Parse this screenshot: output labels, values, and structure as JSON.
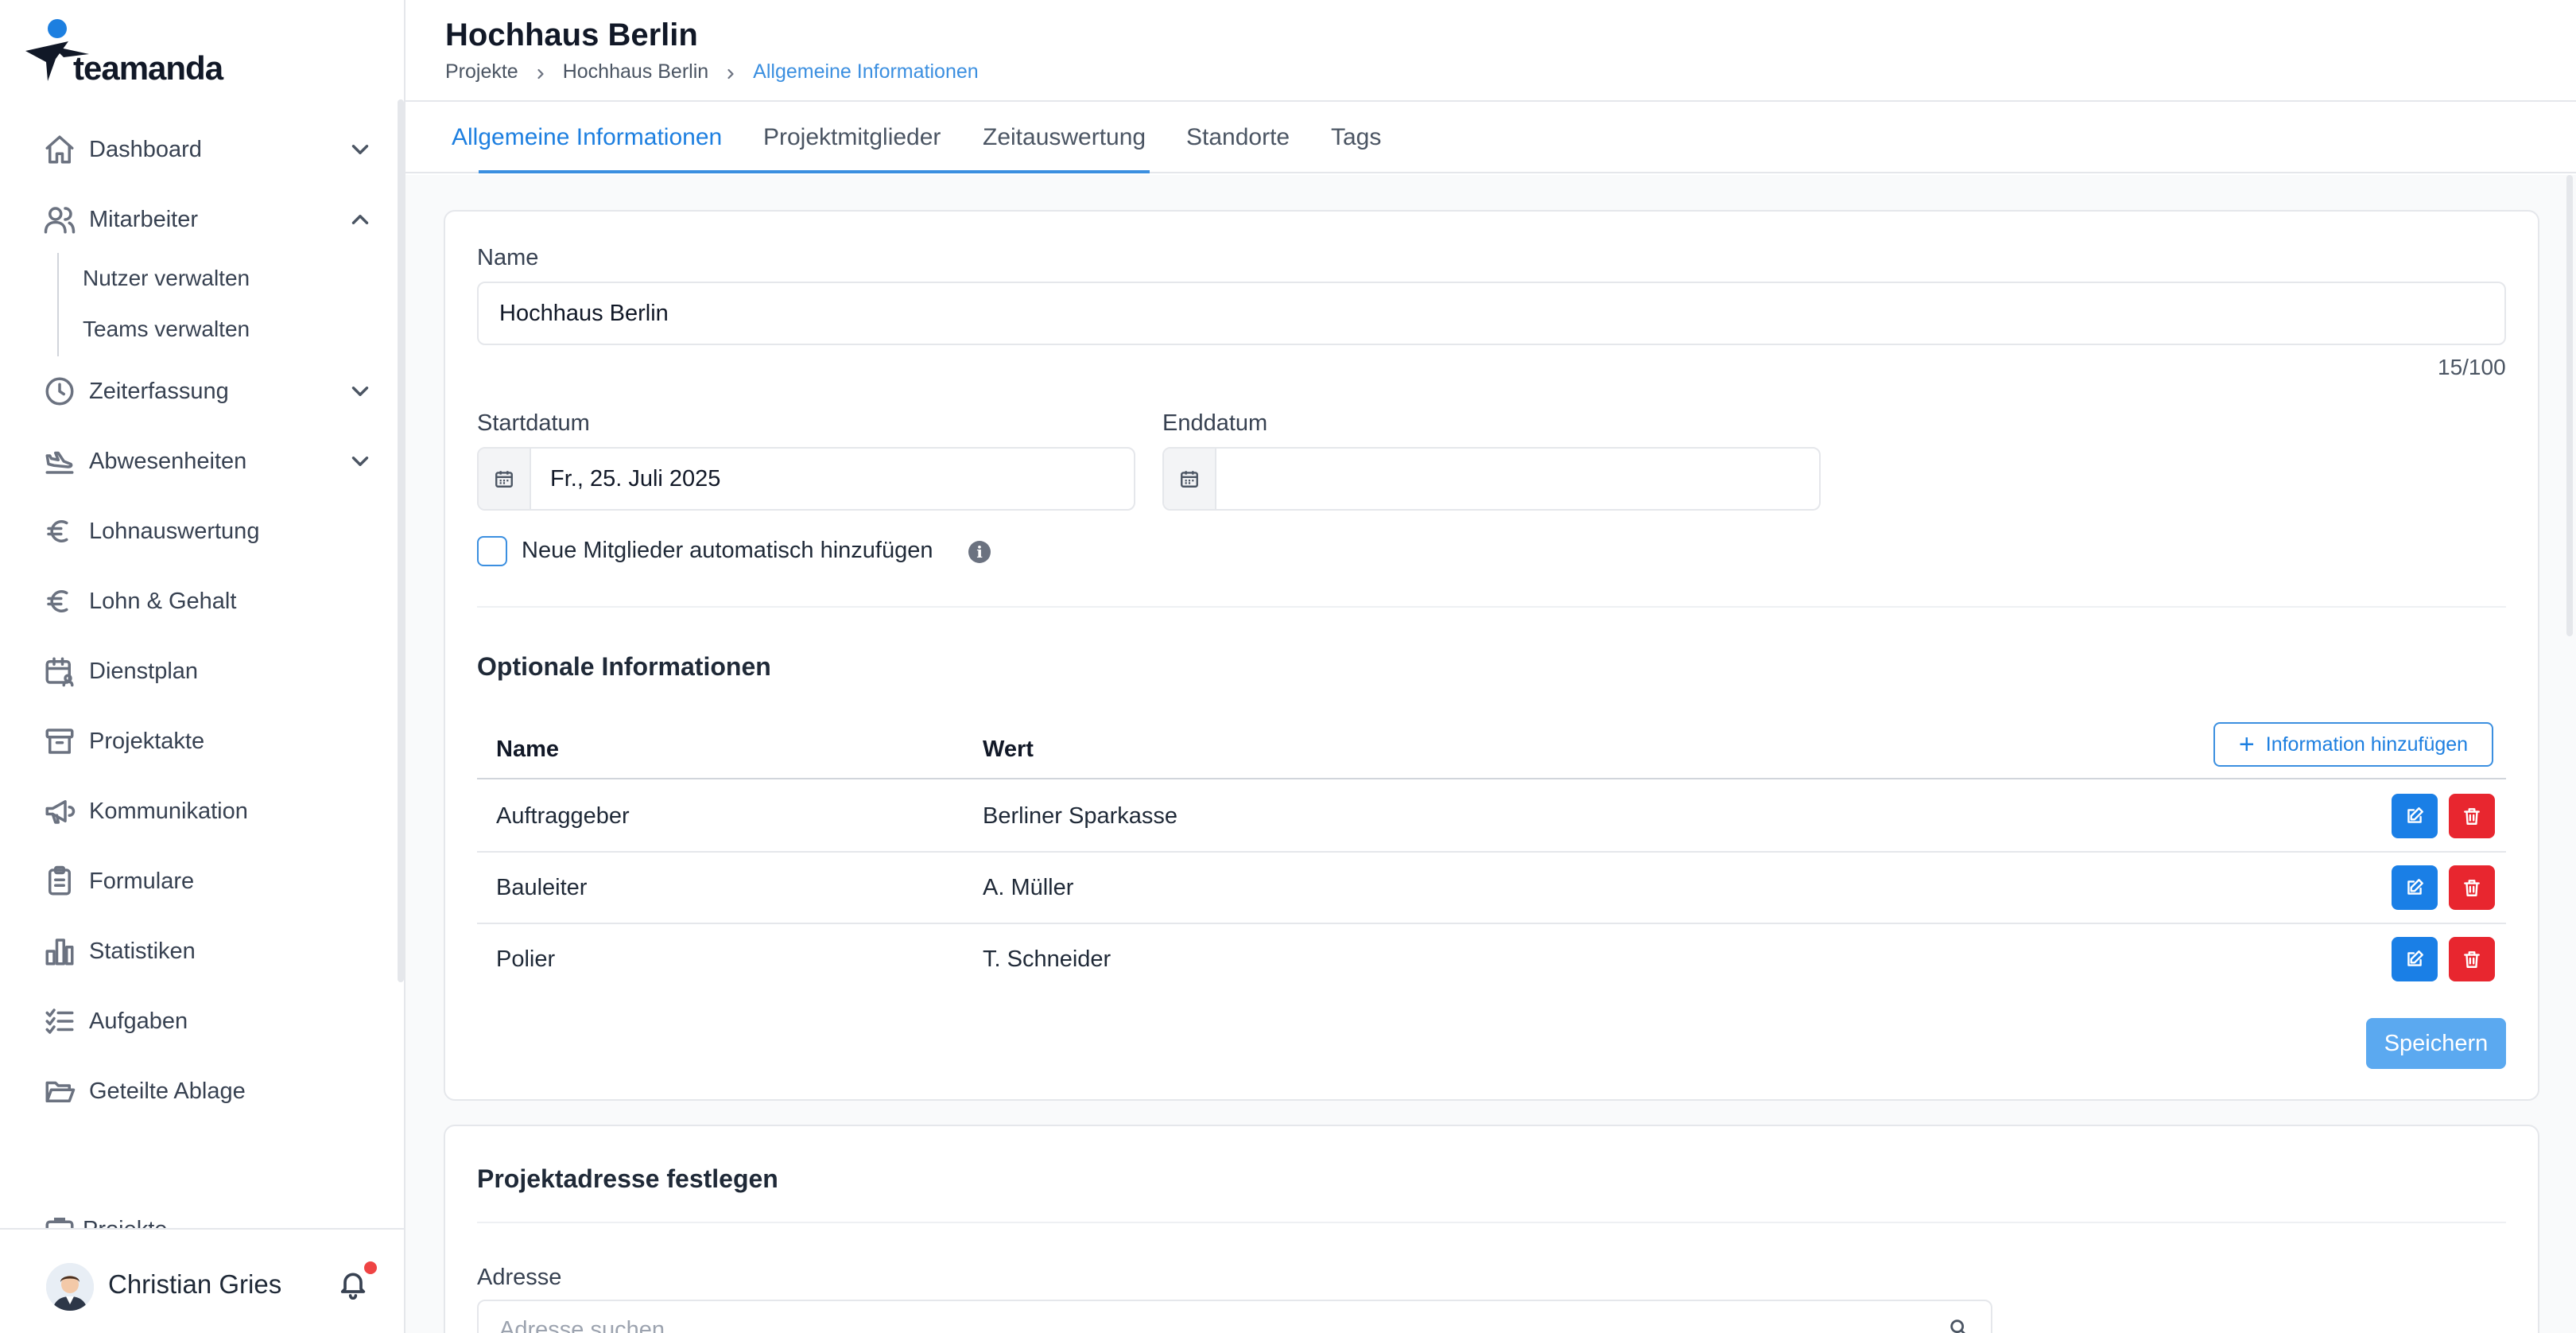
{
  "brand": {
    "name": "teamanda"
  },
  "header": {
    "title": "Hochhaus Berlin",
    "breadcrumb": [
      "Projekte",
      "Hochhaus Berlin",
      "Allgemeine Informationen"
    ]
  },
  "tabs": [
    "Allgemeine Informationen",
    "Projektmitglieder",
    "Zeitauswertung",
    "Standorte",
    "Tags"
  ],
  "sidebar": {
    "items": [
      {
        "label": "Dashboard",
        "icon": "home-icon",
        "chevron": "down"
      },
      {
        "label": "Mitarbeiter",
        "icon": "users-icon",
        "chevron": "up"
      },
      {
        "label": "Zeiterfassung",
        "icon": "clock-icon",
        "chevron": "down"
      },
      {
        "label": "Abwesenheiten",
        "icon": "plane-icon",
        "chevron": "down"
      },
      {
        "label": "Lohnauswertung",
        "icon": "euro-icon"
      },
      {
        "label": "Lohn & Gehalt",
        "icon": "euro-icon"
      },
      {
        "label": "Dienstplan",
        "icon": "calendar-user-icon"
      },
      {
        "label": "Projektakte",
        "icon": "archive-icon"
      },
      {
        "label": "Kommunikation",
        "icon": "megaphone-icon"
      },
      {
        "label": "Formulare",
        "icon": "clipboard-icon"
      },
      {
        "label": "Statistiken",
        "icon": "bar-chart-icon"
      },
      {
        "label": "Aufgaben",
        "icon": "checklist-icon"
      },
      {
        "label": "Geteilte Ablage",
        "icon": "folder-open-icon"
      }
    ],
    "subitems": [
      "Nutzer verwalten",
      "Teams verwalten"
    ],
    "cut_item": "Projekte"
  },
  "user": {
    "name": "Christian Gries"
  },
  "form": {
    "name_label": "Name",
    "name_value": "Hochhaus Berlin",
    "name_counter": "15/100",
    "start_label": "Startdatum",
    "start_value": "Fr., 25. Juli 2025",
    "end_label": "Enddatum",
    "end_value": "",
    "auto_add_label": "Neue Mitglieder automatisch hinzufügen",
    "auto_add_checked": false
  },
  "optional": {
    "title": "Optionale Informationen",
    "col_name": "Name",
    "col_value": "Wert",
    "add_label": "Information hinzufügen",
    "rows": [
      {
        "name": "Auftraggeber",
        "value": "Berliner Sparkasse"
      },
      {
        "name": "Bauleiter",
        "value": "A. Müller"
      },
      {
        "name": "Polier",
        "value": "T. Schneider"
      }
    ],
    "save_label": "Speichern"
  },
  "address": {
    "title": "Projektadresse festlegen",
    "label": "Adresse",
    "placeholder": "Adresse suchen"
  },
  "colors": {
    "accent": "#3b8fe0",
    "edit": "#1a7fe6",
    "delete": "#e8262f",
    "save": "#5ba9f0"
  }
}
